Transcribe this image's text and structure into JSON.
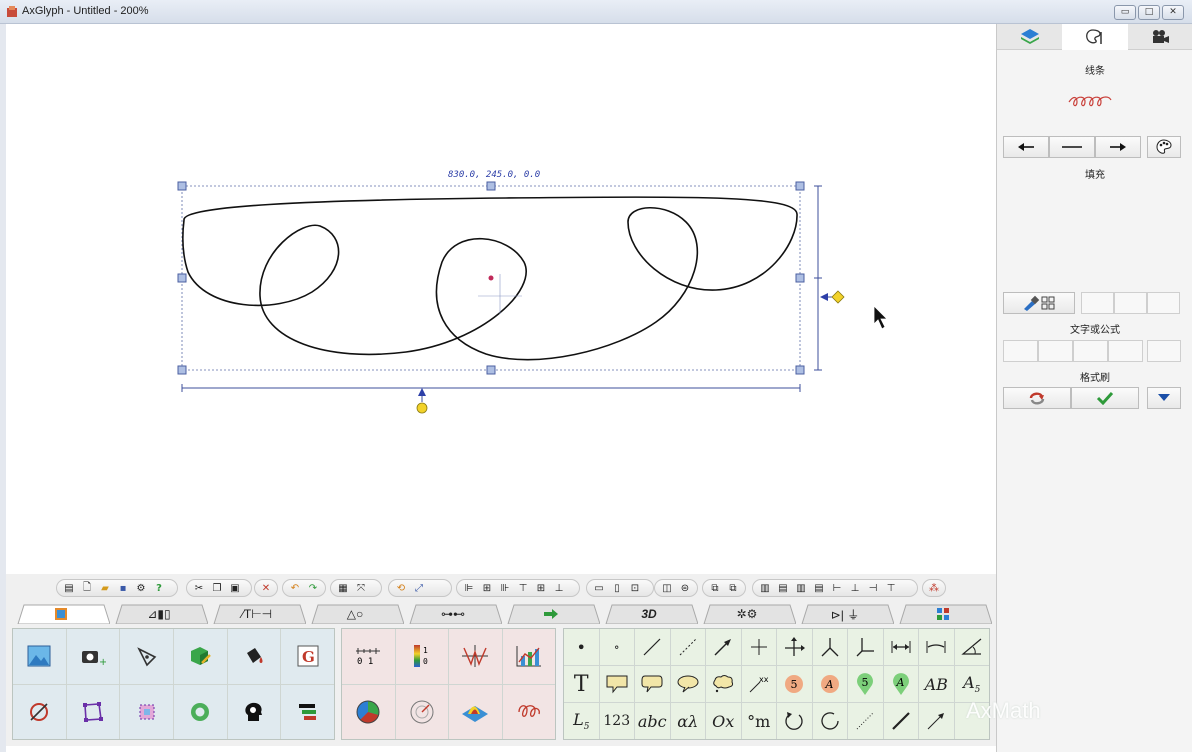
{
  "window": {
    "title": "AxGlyph - Untitled - 200%",
    "min_icon": "minimize-icon",
    "max_icon": "maximize-icon",
    "close_icon": "close-icon"
  },
  "canvas": {
    "coord_readout": "830.0, 245.0, 0.0"
  },
  "right_panel": {
    "tabs": [
      "layers-icon",
      "palette-icon",
      "camera-icon"
    ],
    "line_label": "线条",
    "fill_label": "填充",
    "text_label": "文字或公式",
    "format_brush_label": "格式刷"
  },
  "watermark": "AxMath",
  "colors": {
    "handle": "#aebfe3",
    "accent_green": "#2e9a3a",
    "accent_red": "#c0392b",
    "tab_bar": "#f0f0f0"
  }
}
